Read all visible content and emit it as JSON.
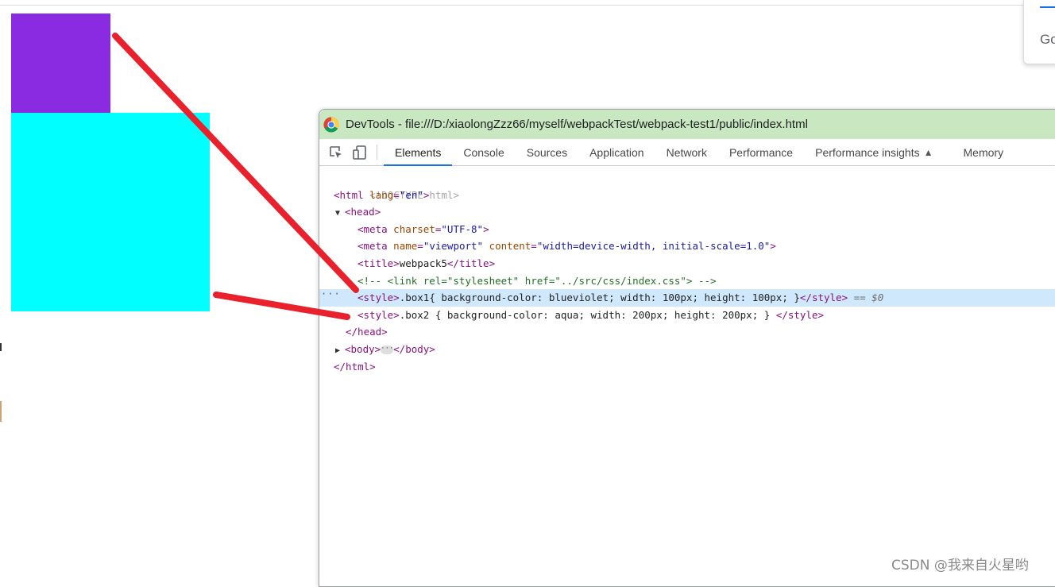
{
  "page": {
    "box1_color": "#8a2be2",
    "box2_color": "#00ffff"
  },
  "google_popup": {
    "text": "Go"
  },
  "devtools": {
    "title": "DevTools - file:///D:/xiaolongZzz66/myself/webpackTest/webpack-test1/public/index.html",
    "title_bar_color": "#c9e7c1",
    "tabs": [
      {
        "label": "Elements",
        "active": true
      },
      {
        "label": "Console"
      },
      {
        "label": "Sources"
      },
      {
        "label": "Application"
      },
      {
        "label": "Network"
      },
      {
        "label": "Performance"
      },
      {
        "label": "Performance insights",
        "icon": "flask-icon"
      },
      {
        "label": "Memory"
      }
    ],
    "dom": {
      "doctype": "<!DOCTYPE html>",
      "html_open": "<html",
      "html_lang_attr": "lang",
      "html_lang_val": "\"en\"",
      "head_open": "<head>",
      "meta1_tag": "<meta",
      "meta1_attr": "charset",
      "meta1_val": "\"UTF-8\"",
      "meta2_tag": "<meta",
      "meta2_attr1": "name",
      "meta2_val1": "\"viewport\"",
      "meta2_attr2": "content",
      "meta2_val2": "\"width=device-width, initial-scale=1.0\"",
      "title_open": "<title>",
      "title_text": "webpack5",
      "title_close": "</title>",
      "comment": "<!-- <link rel=\"stylesheet\" href=\"../src/css/index.css\"> -->",
      "style1_open": "<style>",
      "style1_text": ".box1{ background-color: blueviolet; width: 100px; height: 100px; }",
      "style1_close": "</style>",
      "selected_marker": "== $0",
      "style2_open": "<style>",
      "style2_text": ".box2 { background-color: aqua; width: 200px; height: 200px; } ",
      "style2_close": "</style>",
      "head_close": "</head>",
      "body_open": "<body>",
      "body_close": "</body>",
      "html_close": "</html>"
    }
  },
  "watermark": "CSDN @我来自火星哟"
}
